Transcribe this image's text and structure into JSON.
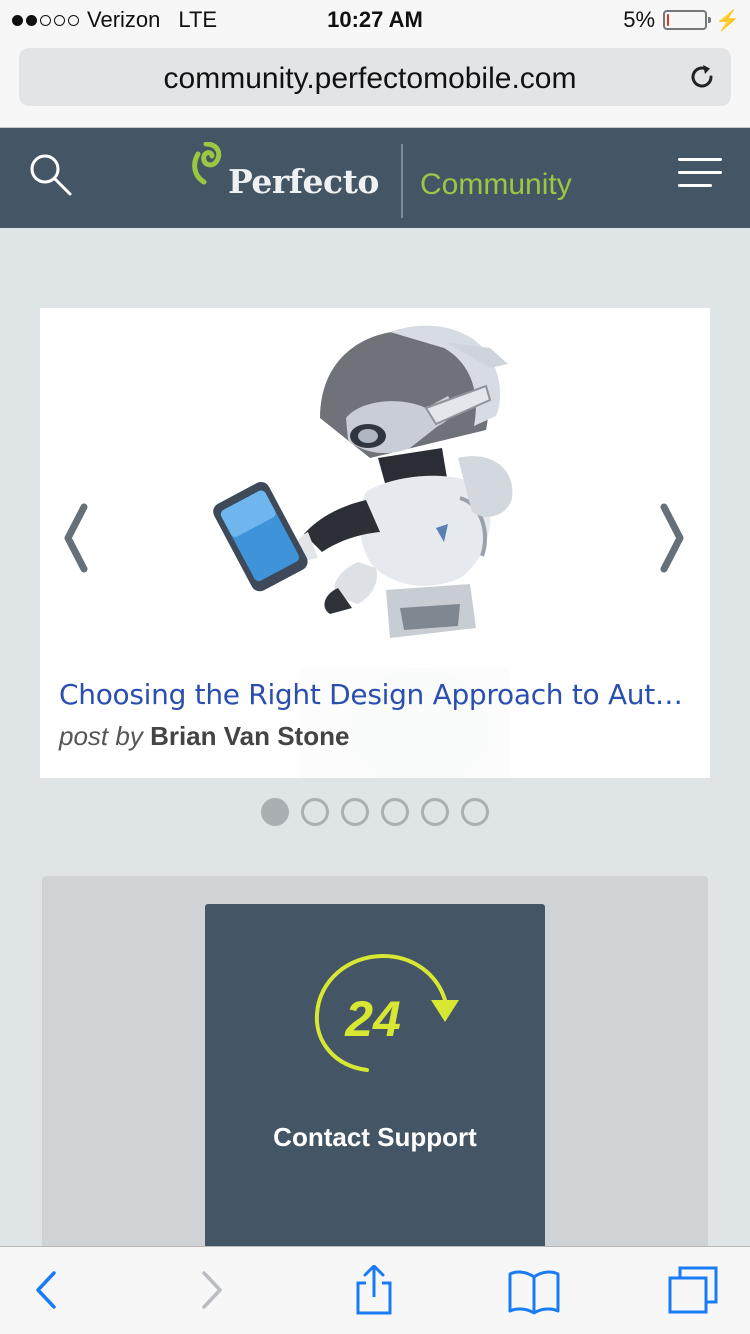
{
  "status_bar": {
    "carrier": "Verizon",
    "network": "LTE",
    "time": "10:27 AM",
    "battery_percent_label": "5%",
    "battery_level": 0.05,
    "signal_bars_on": 2,
    "signal_bars_total": 5
  },
  "browser": {
    "url": "community.perfectomobile.com"
  },
  "site_header": {
    "brand": "Perfecto",
    "section": "Community",
    "brand_color": "#9bc842",
    "header_color": "#445566"
  },
  "carousel": {
    "title": "Choosing the Right Design Approach to Auto…",
    "post_by_label": "post by",
    "author": "Brian Van Stone",
    "slide_count": 6,
    "active_slide": 1,
    "title_color": "#2b4fb0"
  },
  "support": {
    "badge_number": "24",
    "label": "Contact Support",
    "accent_color": "#d8e832"
  },
  "toolbar": {
    "icons": [
      "back-icon",
      "forward-icon",
      "share-icon",
      "bookmarks-icon",
      "tabs-icon"
    ]
  }
}
